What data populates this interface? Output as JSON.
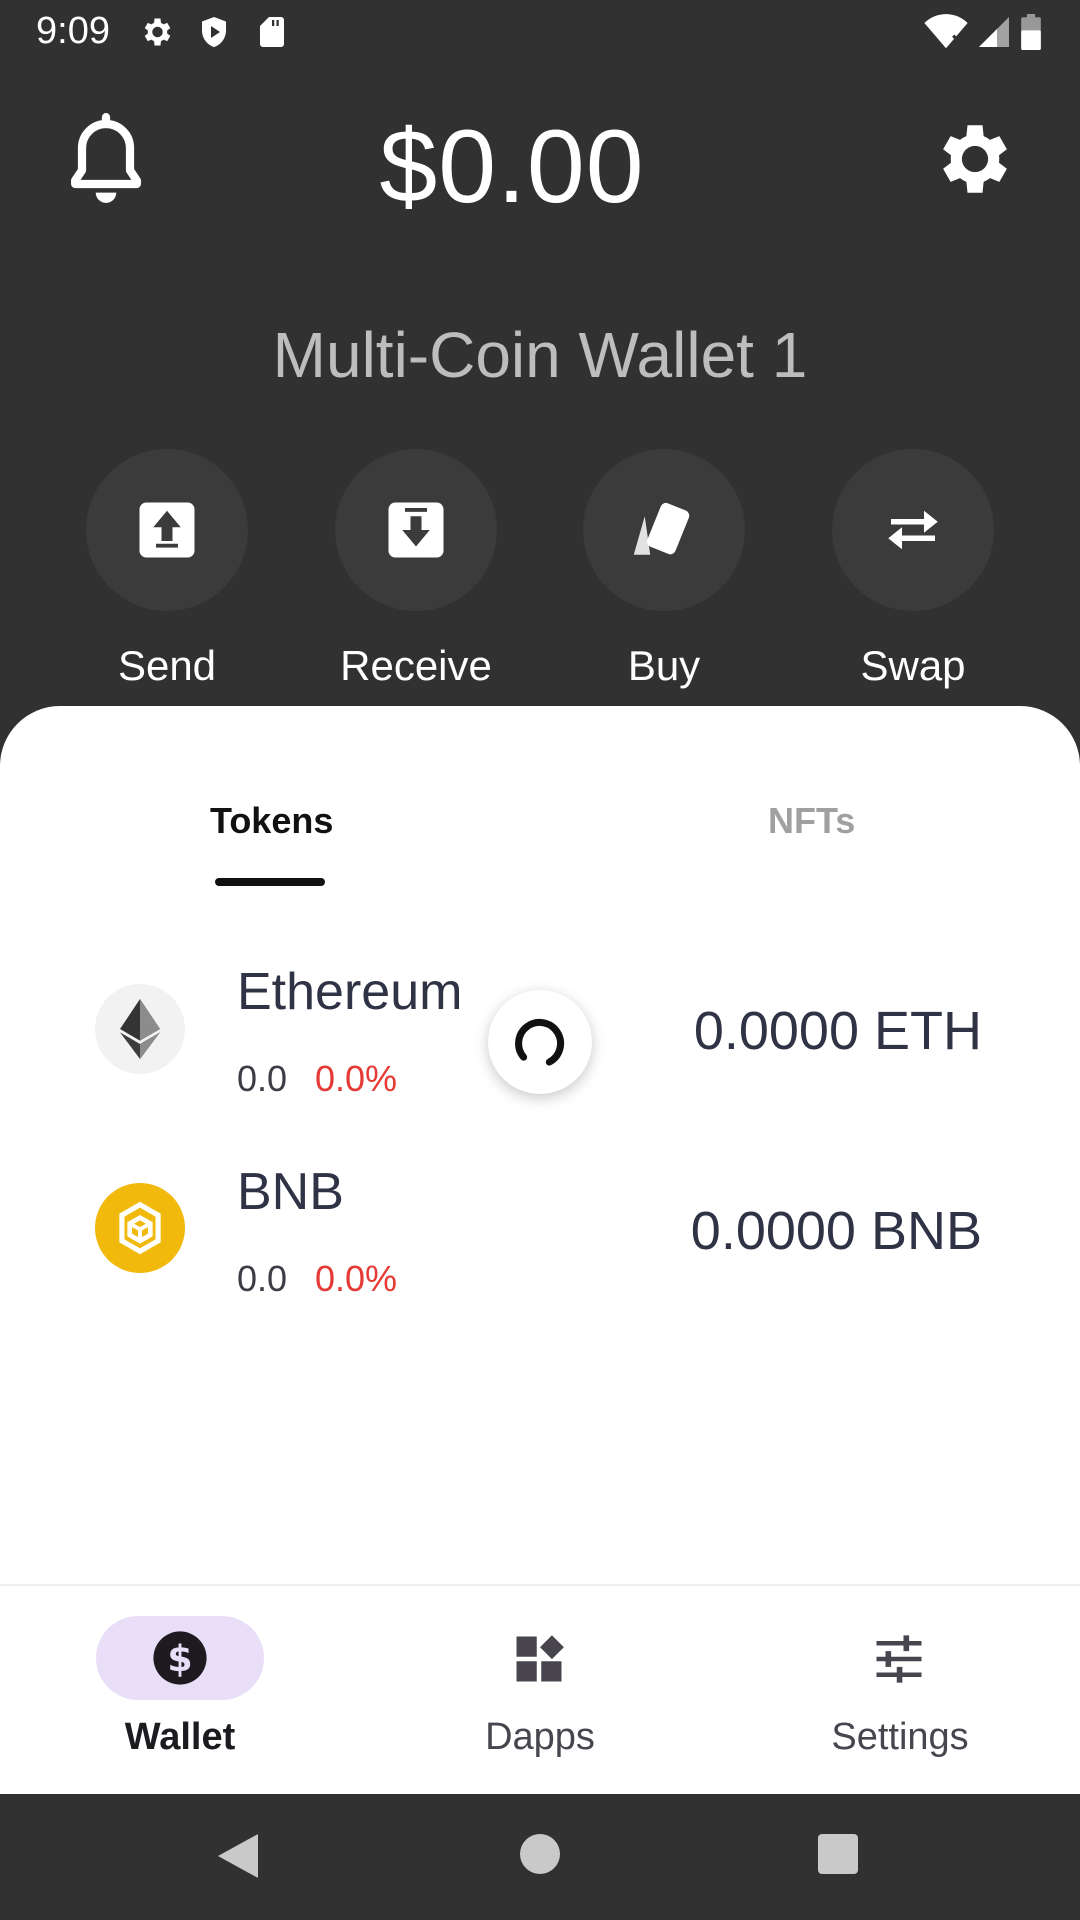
{
  "status_bar": {
    "time": "9:09",
    "left_icons": [
      "gear-icon",
      "shield-play-icon",
      "sd-card-icon"
    ],
    "right_icons": [
      "wifi-icon",
      "signal-icon",
      "battery-icon"
    ]
  },
  "header": {
    "balance": "$0.00",
    "wallet_name": "Multi-Coin Wallet 1"
  },
  "actions": [
    {
      "label": "Send",
      "icon": "upload-icon"
    },
    {
      "label": "Receive",
      "icon": "download-icon"
    },
    {
      "label": "Buy",
      "icon": "cards-icon"
    },
    {
      "label": "Swap",
      "icon": "swap-arrows-icon"
    }
  ],
  "tabs": [
    {
      "label": "Tokens",
      "active": true
    },
    {
      "label": "NFTs",
      "active": false
    }
  ],
  "tokens": [
    {
      "name": "Ethereum",
      "price": "0.0",
      "change": "0.0%",
      "amount": "0.0000  ETH",
      "icon": "ethereum-icon"
    },
    {
      "name": "BNB",
      "price": "0.0",
      "change": "0.0%",
      "amount": "0.0000  BNB",
      "icon": "bnb-icon"
    }
  ],
  "bottom_nav": [
    {
      "label": "Wallet",
      "icon": "dollar-icon",
      "active": true
    },
    {
      "label": "Dapps",
      "icon": "dapps-icon",
      "active": false
    },
    {
      "label": "Settings",
      "icon": "sliders-icon",
      "active": false
    }
  ],
  "colors": {
    "background": "#313131",
    "negative": "#e53935",
    "active_pill": "#e8def8",
    "bnb": "#f0b90b"
  }
}
